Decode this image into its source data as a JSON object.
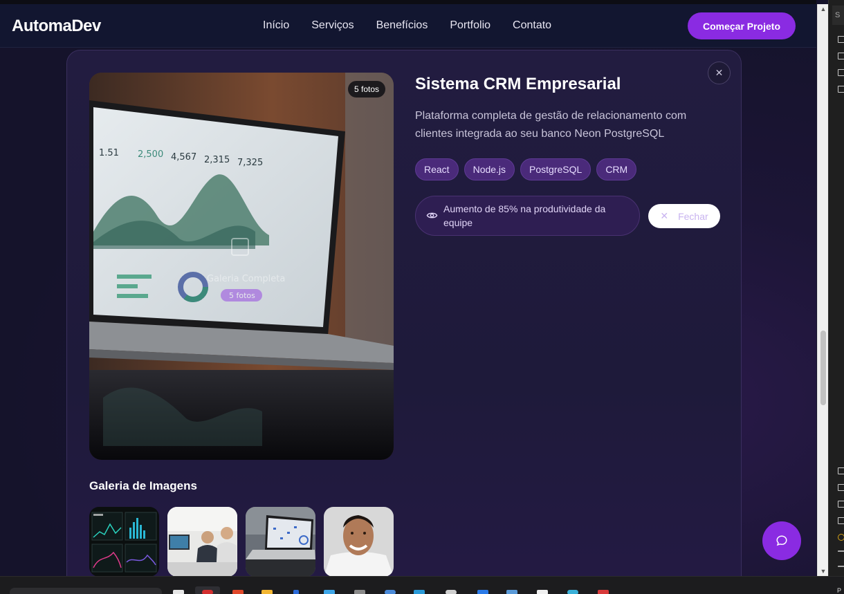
{
  "nav": {
    "brand": "AutomaDev",
    "links": [
      "Início",
      "Serviços",
      "Benefícios",
      "Portfolio",
      "Contato"
    ],
    "cta": "Começar Projeto"
  },
  "modal": {
    "photo_count": "5 fotos",
    "title": "Sistema CRM Empresarial",
    "description": "Plataforma completa de gestão de relacionamento com clientes integrada ao seu banco Neon PostgreSQL",
    "tags": [
      "React",
      "Node.js",
      "PostgreSQL",
      "CRM"
    ],
    "result": "Aumento de 85% na produtividade da equipe",
    "close_label": "Fechar",
    "gallery_title": "Galeria de Imagens",
    "overlay_text": "Galeria Completa",
    "overlay_badge": "5 fotos"
  },
  "laptop_screen": {
    "stats": [
      "1.51",
      "2,500",
      "4,567",
      "2,315",
      "7,325"
    ]
  },
  "colors": {
    "accent": "#8a2be2",
    "tag_bg": "#4a2a7a",
    "page_bg": "#15132b"
  },
  "side_panel": {
    "search_hint": "S"
  },
  "taskbar": {
    "right_hint": "P"
  }
}
